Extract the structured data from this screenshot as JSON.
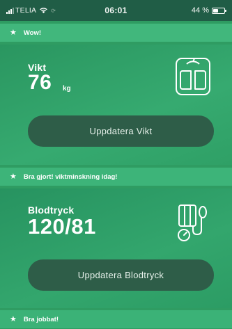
{
  "status_bar": {
    "carrier": "TELIA",
    "time": "06:01",
    "battery_percent": "44 %",
    "battery_level": 0.44,
    "icons": [
      "signal-icon",
      "wifi-icon",
      "sync-icon",
      "battery-icon"
    ]
  },
  "banners": [
    {
      "text": "Wow!",
      "icon": "star-icon"
    },
    {
      "text": "Bra gjort! viktminskning idag!",
      "icon": "star-icon"
    },
    {
      "text": "Bra jobbat!",
      "icon": "star-icon"
    }
  ],
  "weight_card": {
    "label": "Vikt",
    "value": "76",
    "unit": "kg",
    "button_label": "Uppdatera Vikt",
    "icon": "scale-icon"
  },
  "blood_pressure_card": {
    "label": "Blodtryck",
    "value": "120/81",
    "button_label": "Uppdatera Blodtryck",
    "icon": "blood-pressure-icon"
  },
  "colors": {
    "status_bar": "#205d46",
    "banner": "#41b77c",
    "card": "#32a66d",
    "button": "#2e5d48",
    "text": "#ffffff"
  }
}
